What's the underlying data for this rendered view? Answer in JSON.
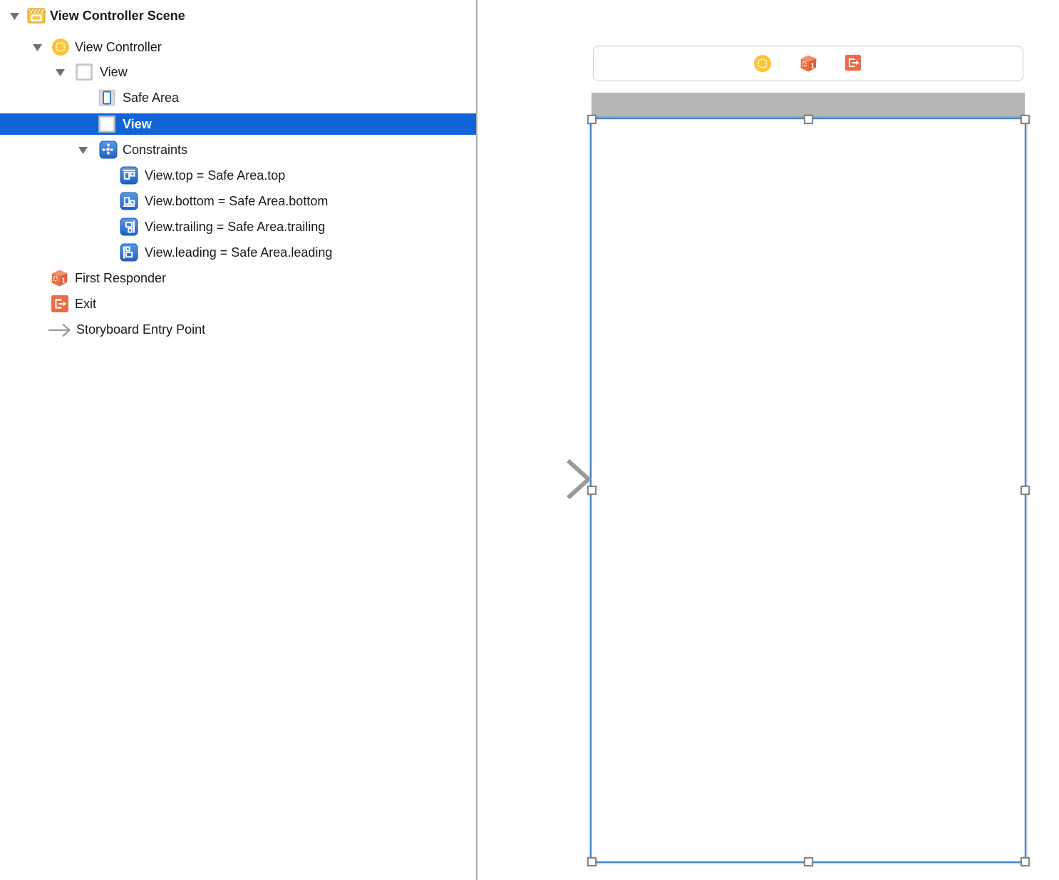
{
  "sidebar": {
    "rows": [
      {
        "label": "View Controller Scene",
        "icon": "scene-icon"
      },
      {
        "label": "View Controller",
        "icon": "view-controller-icon"
      },
      {
        "label": "View",
        "icon": "view-icon"
      },
      {
        "label": "Safe Area",
        "icon": "safe-area-icon"
      },
      {
        "label": "View",
        "icon": "view-icon",
        "selected": true
      },
      {
        "label": "Constraints",
        "icon": "constraints-icon"
      },
      {
        "label": "View.top = Safe Area.top",
        "icon": "constraint-top-icon"
      },
      {
        "label": "View.bottom = Safe Area.bottom",
        "icon": "constraint-bottom-icon"
      },
      {
        "label": "View.trailing = Safe Area.trailing",
        "icon": "constraint-trailing-icon"
      },
      {
        "label": "View.leading = Safe Area.leading",
        "icon": "constraint-leading-icon"
      },
      {
        "label": "First Responder",
        "icon": "first-responder-icon"
      },
      {
        "label": "Exit",
        "icon": "exit-icon"
      },
      {
        "label": "Storyboard Entry Point",
        "icon": "entry-point-arrow-icon"
      }
    ],
    "selection_color": "#1164d8"
  },
  "canvas": {
    "dock_icons": [
      "view-controller-icon",
      "first-responder-icon",
      "exit-icon"
    ],
    "status_bar_color": "#b5b5b5",
    "selection_border_color": "#4a86c4",
    "entry_arrow_color": "#9a9a9a"
  },
  "colors": {
    "xcode_yellow": "#fcc334",
    "xcode_orange": "#ec6a45",
    "constraint_blue": "#2e6fd8"
  }
}
